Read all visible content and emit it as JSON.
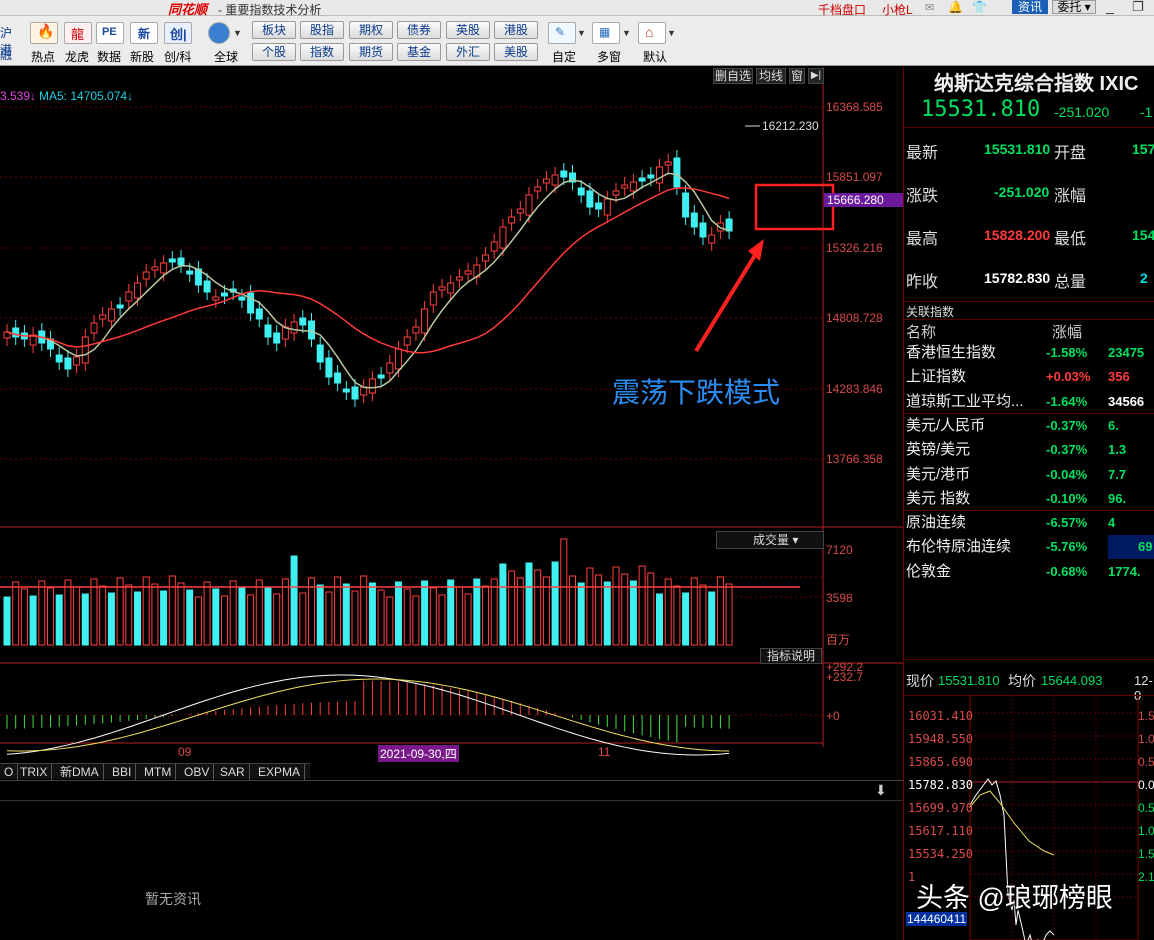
{
  "window": {
    "title": "重要指数技术分析",
    "brand": "同花顺",
    "menu": [
      "千档盘口",
      "小枪L"
    ],
    "buttons": [
      "资讯",
      "委托"
    ]
  },
  "toolbar": {
    "left_items": [
      {
        "label": "沪港",
        "sub": "融"
      },
      {
        "label": "热点",
        "icon": "hot-icon"
      },
      {
        "label": "龙虎",
        "icon": "dragon-icon"
      },
      {
        "label": "数据",
        "icon": "pe-icon"
      },
      {
        "label": "新股",
        "icon": "newstock-icon"
      },
      {
        "label": "创/科",
        "icon": "chuang-icon"
      },
      {
        "label": "全球",
        "icon": "globe-icon"
      }
    ],
    "grid_buttons": [
      [
        "板块",
        "股指",
        "期权",
        "债券",
        "英股",
        "港股"
      ],
      [
        "个股",
        "指数",
        "期货",
        "基金",
        "外汇",
        "美股"
      ]
    ],
    "right_items": [
      {
        "label": "自定",
        "icon": "custom-icon"
      },
      {
        "label": "多窗",
        "icon": "multiwindow-icon"
      },
      {
        "label": "默认",
        "icon": "home-icon"
      }
    ]
  },
  "chart_header": {
    "ma_left": "3.539↓",
    "ma5": "MA5: 14705.074↓",
    "buttons": [
      "删自选",
      "均线",
      "窗"
    ]
  },
  "chart_data": {
    "type": "candlestick",
    "y_ticks": [
      "16368.585",
      "15851.097",
      "15326.216",
      "14808.728",
      "14283.846",
      "13766.358"
    ],
    "current_price_tag": "15666.280",
    "high_label": "16212.230",
    "x_ticks": [
      "09",
      "2021-09-30,四",
      "11"
    ],
    "volume_ticks": [
      "7120",
      "3598",
      "百万"
    ],
    "volume_title": "成交量",
    "macd_ticks": [
      "+292.2",
      "+232.7",
      "+0"
    ],
    "indicator_button": "指标说明",
    "candles_note": "approximate shape of ~90 daily candles with MA lines"
  },
  "annotation": {
    "text": "震荡下跌模式",
    "color": "#2a8cf0",
    "box_color": "#ff2020"
  },
  "indicator_tabs": [
    "O",
    "TRIX",
    "新DMA",
    "BBI",
    "MTM",
    "OBV",
    "SAR",
    "EXPMA"
  ],
  "news": {
    "empty_text": "暂无资讯"
  },
  "quote": {
    "name": "纳斯达克综合指数 IXIC",
    "price": "15531.810",
    "change": "-251.020",
    "change_pct": "-1",
    "rows": [
      {
        "l1": "最新",
        "v1": "15531.810",
        "c1": "#00e060",
        "l2": "开盘",
        "v2": "157",
        "c2": "#00e060"
      },
      {
        "l1": "涨跌",
        "v1": "-251.020",
        "c1": "#00e060",
        "l2": "涨幅",
        "v2": "",
        "c2": "#00e060"
      },
      {
        "l1": "最高",
        "v1": "15828.200",
        "c1": "#ff3b3b",
        "l2": "最低",
        "v2": "154",
        "c2": "#00e060"
      },
      {
        "l1": "昨收",
        "v1": "15782.830",
        "c1": "#ffffff",
        "l2": "总量",
        "v2": "2",
        "c2": "#00e0e0"
      }
    ]
  },
  "related": {
    "title": "关联指数",
    "col_name": "名称",
    "col_change": "涨幅",
    "items": [
      {
        "name": "香港恒生指数",
        "pct": "-1.58%",
        "val": "23475",
        "pct_color": "#00e060",
        "val_color": "#00e060"
      },
      {
        "name": "上证指数",
        "pct": "+0.03%",
        "val": "356",
        "pct_color": "#ff3b3b",
        "val_color": "#ff3b3b"
      },
      {
        "name": "道琼斯工业平均...",
        "pct": "-1.64%",
        "val": "34566",
        "pct_color": "#00e060",
        "val_color": "#ffffff"
      },
      {
        "name": "美元/人民币",
        "pct": "-0.37%",
        "val": "6.",
        "pct_color": "#00e060",
        "val_color": "#00e060"
      },
      {
        "name": "英镑/美元",
        "pct": "-0.37%",
        "val": "1.3",
        "pct_color": "#00e060",
        "val_color": "#00e060"
      },
      {
        "name": "美元/港币",
        "pct": "-0.04%",
        "val": "7.7",
        "pct_color": "#00e060",
        "val_color": "#00e060"
      },
      {
        "name": "美元 指数",
        "pct": "-0.10%",
        "val": "96.",
        "pct_color": "#00e060",
        "val_color": "#00e060"
      },
      {
        "name": "原油连续",
        "pct": "-6.57%",
        "val": "4",
        "pct_color": "#00e060",
        "val_color": "#00e060"
      },
      {
        "name": "布伦特原油连续",
        "pct": "-5.76%",
        "val": "69",
        "pct_color": "#00e060",
        "val_color": "#00e060"
      },
      {
        "name": "伦敦金",
        "pct": "-0.68%",
        "val": "1774.",
        "pct_color": "#00e060",
        "val_color": "#00e060"
      }
    ]
  },
  "intraday": {
    "price_label": "现价",
    "price": "15531.810",
    "avg_label": "均价",
    "avg": "15644.093",
    "time": "12-0",
    "left_ticks": [
      "16031.410",
      "15948.550",
      "15865.690",
      "15782.830",
      "15699.970",
      "15617.110",
      "15534.250",
      "1"
    ],
    "right_ticks": [
      "1.5",
      "1.0",
      "0.5",
      "0.0",
      "0.5",
      "1.0",
      "1.5",
      "2.1"
    ],
    "volume_label": "144460411"
  },
  "watermark": "头条 @琅琊榜眼"
}
